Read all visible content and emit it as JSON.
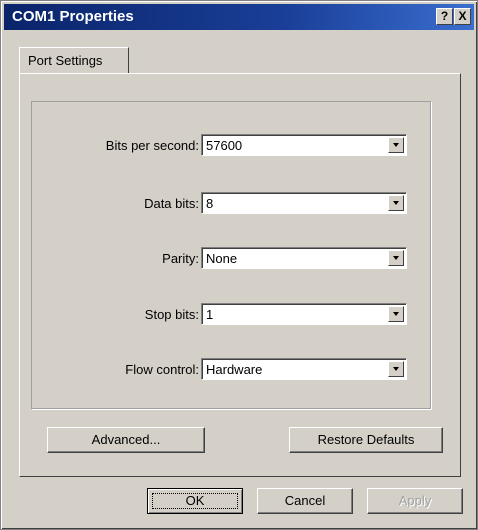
{
  "window": {
    "title": "COM1 Properties",
    "help_glyph": "?",
    "close_glyph": "X"
  },
  "tabs": [
    {
      "label": "Port Settings"
    }
  ],
  "fields": [
    {
      "label": "Bits per second:",
      "value": "57600"
    },
    {
      "label": "Data bits:",
      "value": "8"
    },
    {
      "label": "Parity:",
      "value": "None"
    },
    {
      "label": "Stop bits:",
      "value": "1"
    },
    {
      "label": "Flow control:",
      "value": "Hardware"
    }
  ],
  "buttons": {
    "advanced": "Advanced...",
    "restore": "Restore Defaults",
    "ok": "OK",
    "cancel": "Cancel",
    "apply": "Apply"
  },
  "colors": {
    "titlebar_start": "#0a246a",
    "titlebar_end": "#3a6ed0",
    "face": "#d4d0c8"
  }
}
